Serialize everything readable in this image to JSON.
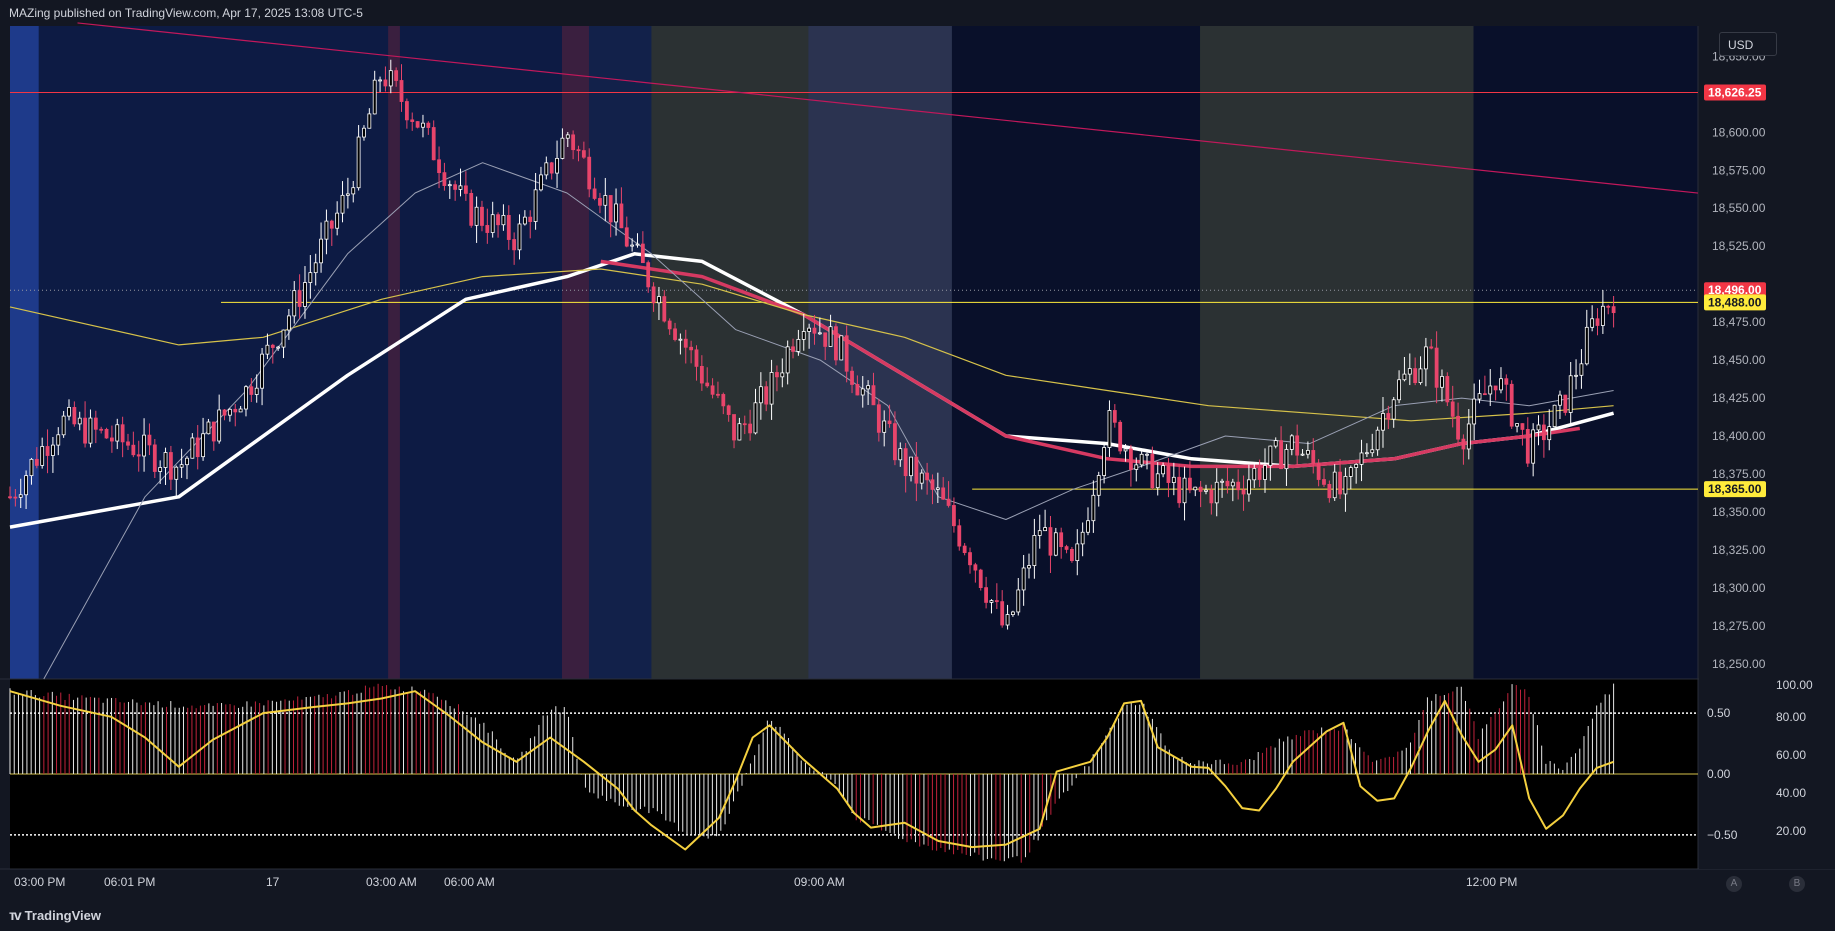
{
  "header": {
    "text": "MAZing published on TradingView.com, Apr 17, 2025 13:08 UTC-5"
  },
  "footer": {
    "brand": "TradingView",
    "logo_icon": "tradingview-logo-icon"
  },
  "currency": "USD",
  "scale_buttons": [
    "A",
    "B"
  ],
  "colors": {
    "background": "#000000",
    "up_candle": "#ffffff",
    "down_candle": "#e8456b",
    "ma_white": "#ffffff",
    "ma_pink": "#d63a62",
    "ma_yellow": "#d6c24a",
    "ma_gray": "#9aa0b4",
    "trendline": "#c2185b",
    "level_red": "#f23645",
    "level_yellow": "#ffeb3b",
    "osc_line": "#f4d03f"
  },
  "price_axis": {
    "ticks": [
      "18,650.00",
      "18,600.00",
      "18,575.00",
      "18,550.00",
      "18,525.00",
      "18,475.00",
      "18,450.00",
      "18,425.00",
      "18,400.00",
      "18,375.00",
      "18,350.00",
      "18,325.00",
      "18,300.00",
      "18,275.00",
      "18,250.00"
    ],
    "tick_values": [
      18650,
      18600,
      18575,
      18550,
      18525,
      18475,
      18450,
      18425,
      18400,
      18375,
      18350,
      18325,
      18300,
      18275,
      18250
    ]
  },
  "price_labels": [
    {
      "text": "18,626.25",
      "value": 18626.25,
      "color": "#f23645",
      "text_color": "#ffffff"
    },
    {
      "text": "18,496.00",
      "value": 18496,
      "color": "#f23645",
      "text_color": "#ffffff"
    },
    {
      "text": "18,488.00",
      "value": 18488,
      "color": "#ffeb3b",
      "text_color": "#131722"
    },
    {
      "text": "18,365.00",
      "value": 18365,
      "color": "#ffeb3b",
      "text_color": "#131722"
    }
  ],
  "osc_axis_left": {
    "ticks": [
      "0.50",
      "0.00",
      "−0.50"
    ],
    "values": [
      0.5,
      0,
      -0.5
    ]
  },
  "osc_axis_right": {
    "ticks": [
      "100.00",
      "80.00",
      "60.00",
      "40.00",
      "20.00"
    ],
    "values": [
      100,
      80,
      60,
      40,
      20
    ]
  },
  "time_axis": {
    "labels": [
      "03:00 PM",
      "06:01 PM",
      "17",
      "03:00 AM",
      "06:00 AM",
      "09:00 AM",
      "12:00 PM"
    ]
  },
  "chart_data": {
    "type": "candlestick",
    "title": "",
    "ylim": [
      18240,
      18670
    ],
    "time_labels": [
      "03:00 PM",
      "06:01 PM",
      "17",
      "03:00 AM",
      "06:00 AM",
      "09:00 AM",
      "12:00 PM"
    ],
    "close_path": [
      {
        "t": 0,
        "p": 18360
      },
      {
        "t": 0.03,
        "p": 18410
      },
      {
        "t": 0.07,
        "p": 18395
      },
      {
        "t": 0.1,
        "p": 18380
      },
      {
        "t": 0.14,
        "p": 18430
      },
      {
        "t": 0.17,
        "p": 18490
      },
      {
        "t": 0.2,
        "p": 18560
      },
      {
        "t": 0.22,
        "p": 18640
      },
      {
        "t": 0.24,
        "p": 18610
      },
      {
        "t": 0.27,
        "p": 18550
      },
      {
        "t": 0.3,
        "p": 18530
      },
      {
        "t": 0.33,
        "p": 18600
      },
      {
        "t": 0.35,
        "p": 18560
      },
      {
        "t": 0.37,
        "p": 18520
      },
      {
        "t": 0.39,
        "p": 18480
      },
      {
        "t": 0.41,
        "p": 18440
      },
      {
        "t": 0.43,
        "p": 18400
      },
      {
        "t": 0.45,
        "p": 18430
      },
      {
        "t": 0.47,
        "p": 18480
      },
      {
        "t": 0.49,
        "p": 18460
      },
      {
        "t": 0.51,
        "p": 18420
      },
      {
        "t": 0.53,
        "p": 18380
      },
      {
        "t": 0.55,
        "p": 18360
      },
      {
        "t": 0.57,
        "p": 18320
      },
      {
        "t": 0.59,
        "p": 18270
      },
      {
        "t": 0.61,
        "p": 18340
      },
      {
        "t": 0.63,
        "p": 18310
      },
      {
        "t": 0.65,
        "p": 18410
      },
      {
        "t": 0.67,
        "p": 18380
      },
      {
        "t": 0.7,
        "p": 18360
      },
      {
        "t": 0.73,
        "p": 18370
      },
      {
        "t": 0.76,
        "p": 18395
      },
      {
        "t": 0.79,
        "p": 18360
      },
      {
        "t": 0.82,
        "p": 18430
      },
      {
        "t": 0.84,
        "p": 18455
      },
      {
        "t": 0.86,
        "p": 18400
      },
      {
        "t": 0.88,
        "p": 18440
      },
      {
        "t": 0.9,
        "p": 18390
      },
      {
        "t": 0.92,
        "p": 18420
      },
      {
        "t": 0.94,
        "p": 18480
      },
      {
        "t": 0.95,
        "p": 18492
      }
    ],
    "moving_averages": [
      {
        "name": "",
        "color": "#ffffff",
        "points": [
          [
            0,
            18340
          ],
          [
            0.1,
            18360
          ],
          [
            0.2,
            18440
          ],
          [
            0.27,
            18490
          ],
          [
            0.33,
            18505
          ],
          [
            0.37,
            18520
          ],
          [
            0.41,
            18515
          ],
          [
            0.47,
            18480
          ],
          [
            0.53,
            18440
          ],
          [
            0.59,
            18400
          ],
          [
            0.65,
            18395
          ],
          [
            0.7,
            18385
          ],
          [
            0.76,
            18380
          ],
          [
            0.82,
            18385
          ],
          [
            0.86,
            18395
          ],
          [
            0.9,
            18400
          ],
          [
            0.95,
            18415
          ]
        ]
      },
      {
        "name": "",
        "color": "#d63a62",
        "points": [
          [
            0.35,
            18515
          ],
          [
            0.41,
            18505
          ],
          [
            0.47,
            18480
          ],
          [
            0.53,
            18440
          ],
          [
            0.59,
            18400
          ],
          [
            0.65,
            18385
          ],
          [
            0.7,
            18380
          ],
          [
            0.76,
            18380
          ],
          [
            0.82,
            18385
          ],
          [
            0.86,
            18395
          ],
          [
            0.9,
            18400
          ],
          [
            0.93,
            18405
          ]
        ]
      },
      {
        "name": "",
        "color": "#d6c24a",
        "points": [
          [
            0,
            18485
          ],
          [
            0.1,
            18460
          ],
          [
            0.15,
            18465
          ],
          [
            0.22,
            18490
          ],
          [
            0.28,
            18505
          ],
          [
            0.35,
            18510
          ],
          [
            0.41,
            18500
          ],
          [
            0.47,
            18480
          ],
          [
            0.53,
            18465
          ],
          [
            0.59,
            18440
          ],
          [
            0.65,
            18430
          ],
          [
            0.71,
            18420
          ],
          [
            0.77,
            18415
          ],
          [
            0.83,
            18410
          ],
          [
            0.9,
            18415
          ],
          [
            0.95,
            18420
          ]
        ]
      },
      {
        "name": "",
        "color": "#9aa0b4",
        "points": [
          [
            0.02,
            18240
          ],
          [
            0.08,
            18360
          ],
          [
            0.14,
            18430
          ],
          [
            0.2,
            18520
          ],
          [
            0.24,
            18560
          ],
          [
            0.28,
            18580
          ],
          [
            0.33,
            18560
          ],
          [
            0.38,
            18520
          ],
          [
            0.43,
            18470
          ],
          [
            0.48,
            18450
          ],
          [
            0.52,
            18420
          ],
          [
            0.55,
            18360
          ],
          [
            0.59,
            18345
          ],
          [
            0.63,
            18365
          ],
          [
            0.67,
            18380
          ],
          [
            0.72,
            18400
          ],
          [
            0.77,
            18395
          ],
          [
            0.82,
            18420
          ],
          [
            0.86,
            18425
          ],
          [
            0.9,
            18420
          ],
          [
            0.95,
            18430
          ]
        ]
      }
    ],
    "trendline": {
      "from": [
        0.04,
        18672
      ],
      "to": [
        1.0,
        18560
      ]
    },
    "horizontal_levels": [
      {
        "value": 18626.25,
        "from": 0,
        "to": 1.0,
        "color": "#f23645"
      },
      {
        "value": 18488,
        "from": 0.125,
        "to": 1.0,
        "color": "#ffeb3b"
      },
      {
        "value": 18365,
        "from": 0.57,
        "to": 1.0,
        "color": "#ffeb3b"
      }
    ],
    "background_bands": [
      {
        "from": 0.0,
        "to": 0.017,
        "color": "#1e3a8a"
      },
      {
        "from": 0.017,
        "to": 0.224,
        "color": "#0d1b44"
      },
      {
        "from": 0.224,
        "to": 0.231,
        "color": "#3a1f3f"
      },
      {
        "from": 0.231,
        "to": 0.327,
        "color": "#0d1b44"
      },
      {
        "from": 0.327,
        "to": 0.343,
        "color": "#3a1f3f"
      },
      {
        "from": 0.343,
        "to": 0.38,
        "color": "#12214a"
      },
      {
        "from": 0.38,
        "to": 0.473,
        "color": "#2b3133"
      },
      {
        "from": 0.473,
        "to": 0.558,
        "color": "#2b3350"
      },
      {
        "from": 0.558,
        "to": 0.705,
        "color": "#09102a"
      },
      {
        "from": 0.705,
        "to": 0.867,
        "color": "#2b3133"
      },
      {
        "from": 0.867,
        "to": 1.0,
        "color": "#09102a"
      }
    ],
    "oscillator": {
      "ylim": [
        -0.78,
        0.78
      ],
      "levels": [
        0.5,
        0,
        -0.5
      ],
      "signal": [
        [
          0,
          0.68
        ],
        [
          0.03,
          0.56
        ],
        [
          0.06,
          0.47
        ],
        [
          0.08,
          0.3
        ],
        [
          0.1,
          0.06
        ],
        [
          0.12,
          0.28
        ],
        [
          0.15,
          0.5
        ],
        [
          0.18,
          0.55
        ],
        [
          0.2,
          0.58
        ],
        [
          0.22,
          0.62
        ],
        [
          0.24,
          0.68
        ],
        [
          0.26,
          0.48
        ],
        [
          0.28,
          0.26
        ],
        [
          0.3,
          0.1
        ],
        [
          0.32,
          0.3
        ],
        [
          0.34,
          0.1
        ],
        [
          0.36,
          -0.12
        ],
        [
          0.37,
          -0.3
        ],
        [
          0.38,
          -0.42
        ],
        [
          0.4,
          -0.62
        ],
        [
          0.42,
          -0.36
        ],
        [
          0.43,
          -0.05
        ],
        [
          0.44,
          0.3
        ],
        [
          0.45,
          0.4
        ],
        [
          0.47,
          0.12
        ],
        [
          0.49,
          -0.12
        ],
        [
          0.5,
          -0.32
        ],
        [
          0.51,
          -0.44
        ],
        [
          0.53,
          -0.4
        ],
        [
          0.55,
          -0.55
        ],
        [
          0.57,
          -0.6
        ],
        [
          0.59,
          -0.58
        ],
        [
          0.61,
          -0.45
        ],
        [
          0.62,
          0.02
        ],
        [
          0.64,
          0.1
        ],
        [
          0.65,
          0.3
        ],
        [
          0.66,
          0.58
        ],
        [
          0.67,
          0.6
        ],
        [
          0.68,
          0.22
        ],
        [
          0.7,
          0.06
        ],
        [
          0.71,
          0.05
        ],
        [
          0.72,
          -0.1
        ],
        [
          0.73,
          -0.28
        ],
        [
          0.74,
          -0.3
        ],
        [
          0.75,
          -0.12
        ],
        [
          0.76,
          0.1
        ],
        [
          0.78,
          0.35
        ],
        [
          0.79,
          0.42
        ],
        [
          0.8,
          -0.1
        ],
        [
          0.81,
          -0.22
        ],
        [
          0.82,
          -0.2
        ],
        [
          0.83,
          0.05
        ],
        [
          0.84,
          0.35
        ],
        [
          0.85,
          0.6
        ],
        [
          0.86,
          0.32
        ],
        [
          0.87,
          0.1
        ],
        [
          0.88,
          0.2
        ],
        [
          0.89,
          0.4
        ],
        [
          0.9,
          -0.2
        ],
        [
          0.91,
          -0.45
        ],
        [
          0.92,
          -0.34
        ],
        [
          0.93,
          -0.12
        ],
        [
          0.94,
          0.05
        ],
        [
          0.95,
          0.1
        ]
      ],
      "histogram": [
        [
          0,
          0.68
        ],
        [
          0.06,
          0.6
        ],
        [
          0.12,
          0.55
        ],
        [
          0.18,
          0.62
        ],
        [
          0.22,
          0.72
        ],
        [
          0.25,
          0.68
        ],
        [
          0.28,
          0.42
        ],
        [
          0.3,
          0.08
        ],
        [
          0.32,
          0.55
        ],
        [
          0.33,
          0.52
        ],
        [
          0.34,
          -0.12
        ],
        [
          0.36,
          -0.25
        ],
        [
          0.38,
          -0.3
        ],
        [
          0.4,
          -0.48
        ],
        [
          0.42,
          -0.52
        ],
        [
          0.43,
          -0.2
        ],
        [
          0.45,
          0.48
        ],
        [
          0.47,
          0.1
        ],
        [
          0.49,
          -0.1
        ],
        [
          0.5,
          -0.35
        ],
        [
          0.52,
          -0.48
        ],
        [
          0.54,
          -0.58
        ],
        [
          0.56,
          -0.64
        ],
        [
          0.58,
          -0.7
        ],
        [
          0.6,
          -0.7
        ],
        [
          0.61,
          -0.5
        ],
        [
          0.62,
          -0.25
        ],
        [
          0.64,
          0.1
        ],
        [
          0.66,
          0.55
        ],
        [
          0.67,
          0.6
        ],
        [
          0.69,
          0.12
        ],
        [
          0.71,
          0.1
        ],
        [
          0.73,
          0.08
        ],
        [
          0.75,
          0.25
        ],
        [
          0.77,
          0.35
        ],
        [
          0.79,
          0.38
        ],
        [
          0.81,
          0.08
        ],
        [
          0.83,
          0.25
        ],
        [
          0.84,
          0.62
        ],
        [
          0.86,
          0.72
        ],
        [
          0.87,
          0.3
        ],
        [
          0.89,
          0.72
        ],
        [
          0.9,
          0.65
        ],
        [
          0.91,
          0.1
        ],
        [
          0.92,
          0.05
        ],
        [
          0.93,
          0.22
        ],
        [
          0.94,
          0.55
        ],
        [
          0.95,
          0.72
        ]
      ]
    }
  }
}
